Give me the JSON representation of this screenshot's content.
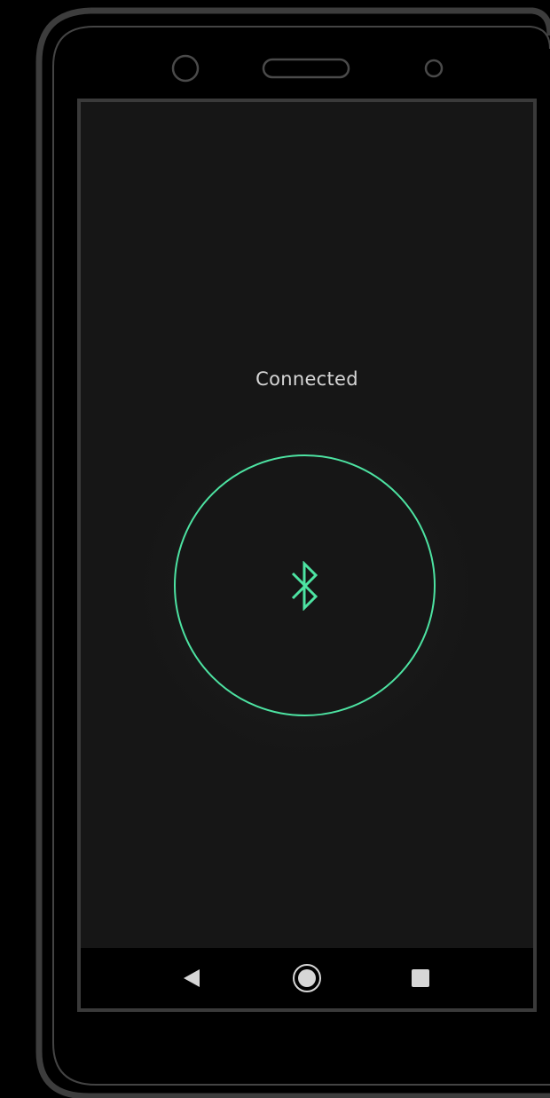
{
  "screen": {
    "status_text": "Connected"
  },
  "connect_button": {
    "icon": "bluetooth-icon",
    "accent_color": "#4de3a2"
  },
  "nav_bar": {
    "back_icon": "back-triangle-icon",
    "home_icon": "home-circle-icon",
    "recents_icon": "recents-square-icon"
  },
  "colors": {
    "background": "#161616",
    "frame": "#3d3d3d",
    "text": "#d6d6d6"
  }
}
